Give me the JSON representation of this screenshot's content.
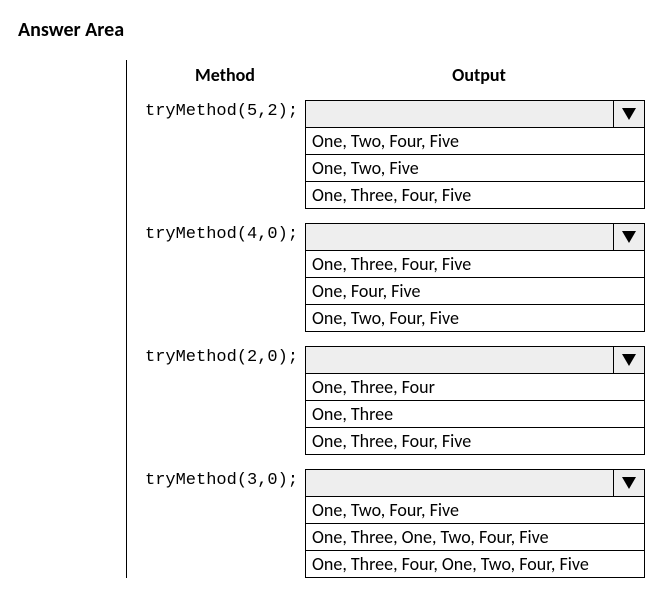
{
  "page_title": "Answer Area",
  "headers": {
    "method": "Method",
    "output": "Output"
  },
  "rows": [
    {
      "method": "tryMethod(5,2);",
      "selected": "",
      "options": [
        "One, Two, Four, Five",
        "One, Two, Five",
        "One, Three, Four, Five"
      ]
    },
    {
      "method": "tryMethod(4,0);",
      "selected": "",
      "options": [
        "One, Three, Four, Five",
        "One, Four, Five",
        "One, Two, Four, Five"
      ]
    },
    {
      "method": "tryMethod(2,0);",
      "selected": "",
      "options": [
        "One, Three, Four",
        "One, Three",
        "One, Three, Four, Five"
      ]
    },
    {
      "method": "tryMethod(3,0);",
      "selected": "",
      "options": [
        "One, Two, Four, Five",
        "One, Three, One, Two, Four, Five",
        "One, Three, Four, One, Two, Four, Five"
      ]
    }
  ]
}
